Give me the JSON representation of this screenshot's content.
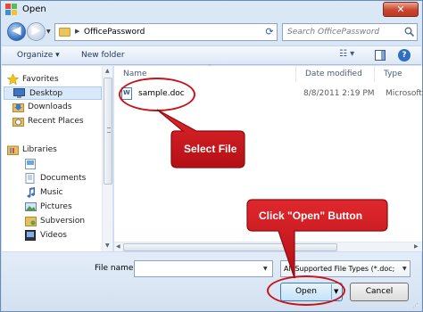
{
  "window": {
    "title": "Open",
    "close_glyph": "✕"
  },
  "address_bar": {
    "path": "OfficePassword",
    "search_placeholder": "Search OfficePassword"
  },
  "toolbar": {
    "organize_label": "Organize ▾",
    "new_folder_label": "New folder",
    "views_label": "☷ ▾",
    "help_label": "?"
  },
  "nav_pane": {
    "favorites_label": "Favorites",
    "favorites": [
      {
        "label": "Desktop",
        "icon": "desktop-icon",
        "selected": true
      },
      {
        "label": "Downloads",
        "icon": "downloads-icon"
      },
      {
        "label": "Recent Places",
        "icon": "recent-places-icon"
      }
    ],
    "libraries_label": "Libraries",
    "libraries": [
      {
        "label": "Documents",
        "icon": "documents-icon"
      },
      {
        "label": "Music",
        "icon": "music-icon"
      },
      {
        "label": "Pictures",
        "icon": "pictures-icon"
      },
      {
        "label": "Subversion",
        "icon": "subversion-icon"
      },
      {
        "label": "Videos",
        "icon": "videos-icon"
      }
    ]
  },
  "file_list": {
    "columns": [
      "Name",
      "Date modified",
      "Type"
    ],
    "files": [
      {
        "name": "sample.doc",
        "date_modified": "8/8/2011 2:19 PM",
        "type": "Microsoft"
      }
    ]
  },
  "bottom": {
    "file_name_label": "File name:",
    "file_name_value": "",
    "file_type_value": "All Supported File Types (*.doc;",
    "open_label": "Open",
    "cancel_label": "Cancel"
  },
  "annotations": {
    "select_file": "Select File",
    "click_open": "Click \"Open\" Button",
    "color": "#c8141b"
  }
}
